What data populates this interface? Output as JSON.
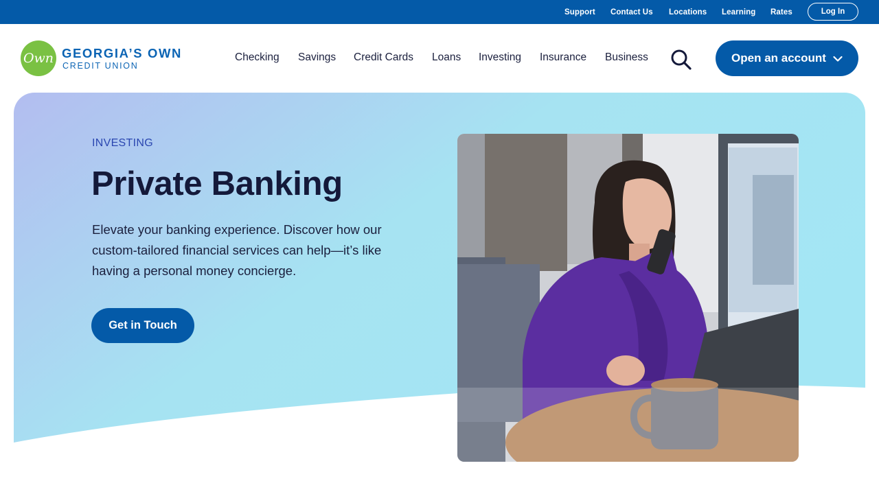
{
  "utility": {
    "links": [
      "Support",
      "Contact Us",
      "Locations",
      "Learning",
      "Rates"
    ],
    "login_label": "Log In"
  },
  "brand": {
    "logo_mark": "Own",
    "name_line1": "GEORGIA’S OWN",
    "name_line2": "CREDIT UNION",
    "colors": {
      "primary": "#045aa8",
      "logo_green": "#7ac143",
      "accent_blue": "#0b64b4"
    }
  },
  "nav": {
    "items": [
      "Checking",
      "Savings",
      "Credit Cards",
      "Loans",
      "Investing",
      "Insurance",
      "Business"
    ],
    "search_icon": "search-icon",
    "open_account_label": "Open an account",
    "open_account_icon": "chevron-down-icon"
  },
  "hero": {
    "eyebrow": "INVESTING",
    "title": "Private Banking",
    "description": "Elevate your banking experience. Discover how our custom-tailored financial services can help—it’s like having a personal money concierge.",
    "cta_label": "Get in Touch"
  }
}
